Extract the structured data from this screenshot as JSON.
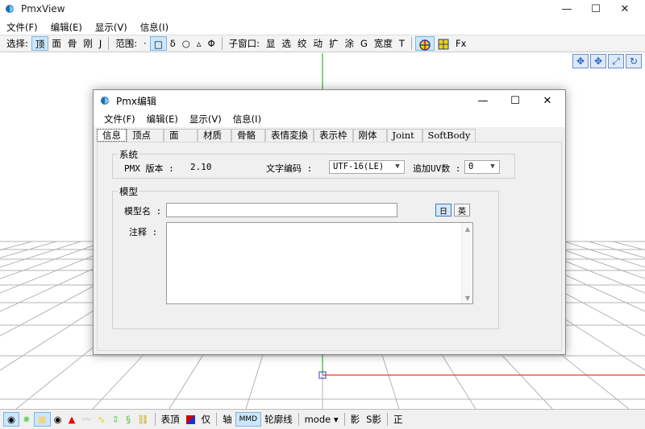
{
  "main": {
    "title": "PmxView",
    "menu": [
      "文件(F)",
      "编辑(E)",
      "显示(V)",
      "信息(I)"
    ],
    "toolbar": {
      "select_label": "选择:",
      "select_items": [
        "顶",
        "面",
        "骨",
        "刚",
        "J"
      ],
      "range_label": "范围:",
      "range_items": [
        "·",
        "□",
        "δ",
        "○",
        "▵",
        "Φ"
      ],
      "subwin_label": "子窗口:",
      "subwin_items": [
        "显",
        "选",
        "绞",
        "动",
        "扩",
        "涂",
        "G",
        "宽度",
        "T"
      ],
      "fx": "Fx"
    },
    "bottom": {
      "surface_label": "表頂",
      "only_label": "仅",
      "axis_label": "轴",
      "mmd_label": "MMD",
      "outline_label": "轮廓线",
      "mode_label": "mode ▾",
      "shadow_label": "影",
      "sshadow_label": "S影",
      "front_label": "正"
    }
  },
  "dialog": {
    "title": "Pmx编辑",
    "menu": [
      "文件(F)",
      "编辑(E)",
      "显示(V)",
      "信息(I)"
    ],
    "tabs": [
      "信息",
      "顶点",
      "面",
      "材质",
      "骨骼",
      "表情変換",
      "表示枠",
      "刚体",
      "Joint",
      "SoftBody"
    ],
    "system_group": "系统",
    "pmx_version_label": "PMX 版本 :",
    "pmx_version_value": "2.10",
    "encoding_label": "文字编码 :",
    "encoding_value": "UTF-16(LE)",
    "uv_label": "追加UV数 :",
    "uv_value": "0",
    "model_group": "模型",
    "model_name_label": "模型名 :",
    "model_name_value": "",
    "comment_label": "注释 :",
    "comment_value": "",
    "lang_jp": "日",
    "lang_en": "英"
  },
  "colors": {
    "accent": "#0078d7",
    "y_axis": "#00aa00",
    "x_axis": "#ff3030",
    "grid": "#b4b4b4"
  }
}
